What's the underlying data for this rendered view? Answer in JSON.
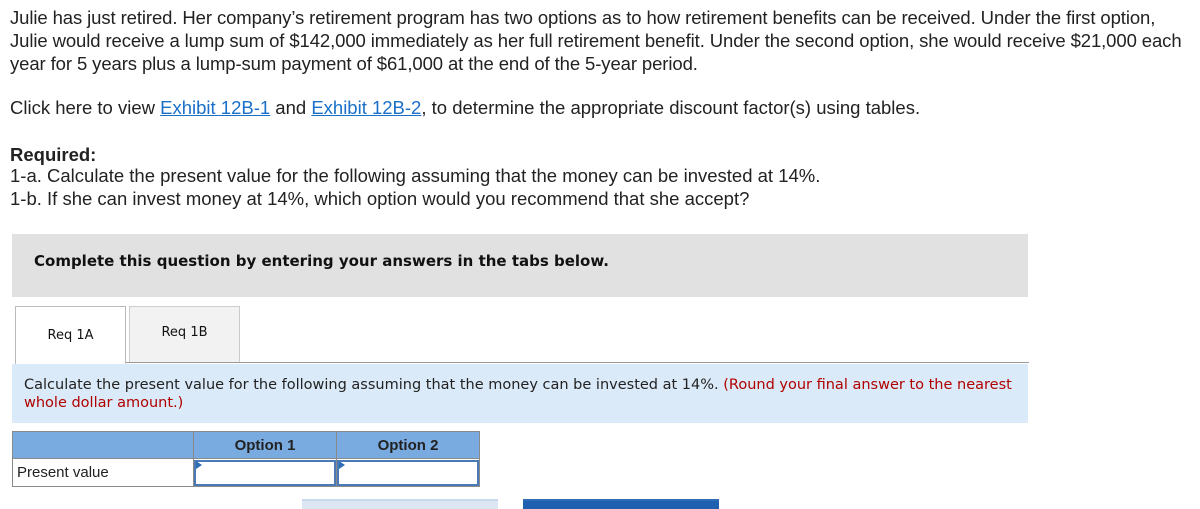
{
  "problem": {
    "intro": "Julie has just retired. Her company’s retirement program has two options as to how retirement benefits can be received. Under the first option, Julie would receive a lump sum of $142,000 immediately as her full retirement benefit. Under the second option, she would receive $21,000 each year for 5 years plus a lump-sum payment of $61,000 at the end of the 5-year period.",
    "exhibit_prefix": "Click here to view ",
    "exhibit_link_1": "Exhibit 12B-1",
    "exhibit_middle": " and ",
    "exhibit_link_2": "Exhibit 12B-2",
    "exhibit_suffix": ", to determine the appropriate discount factor(s) using tables.",
    "required_title": "Required:",
    "required_items": [
      "1-a. Calculate the present value for the following assuming that the money can be invested at 14%.",
      "1-b. If she can invest money at 14%, which option would you recommend that she accept?"
    ]
  },
  "banner": {
    "text": "Complete this question by entering your answers in the tabs below."
  },
  "tabs": [
    {
      "label": "Req 1A",
      "active": true
    },
    {
      "label": "Req 1B",
      "active": false
    }
  ],
  "instructions": {
    "text": "Calculate the present value for the following assuming that the money can be invested at 14%. ",
    "note": "(Round your final answer to the nearest whole dollar amount.)"
  },
  "answer_table": {
    "headers": [
      "",
      "Option 1",
      "Option 2"
    ],
    "rows": [
      {
        "label": "Present value",
        "values": [
          "",
          ""
        ]
      }
    ]
  },
  "colors": {
    "link": "#1a6fc9",
    "table_header": "#7aabe0",
    "instruction_bg": "#dbeaf8",
    "note_red": "#b00000",
    "next_button": "#1f5fb0"
  }
}
